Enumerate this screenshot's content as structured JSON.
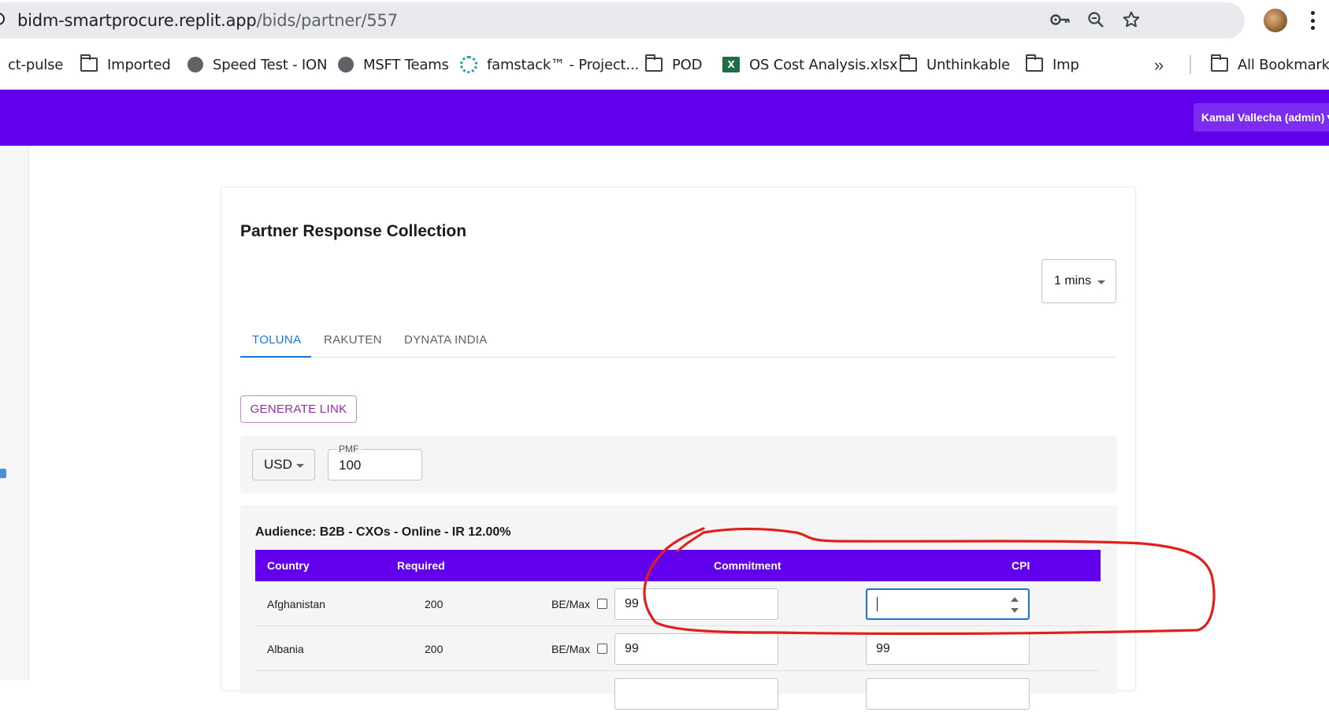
{
  "browser": {
    "url_host": "bidm-smartprocure.replit.app",
    "url_path": "/bids/partner/557",
    "bookmarks": [
      {
        "label": "ct-pulse",
        "icon": "none"
      },
      {
        "label": "Imported",
        "icon": "folder-icon"
      },
      {
        "label": "Speed Test - ION",
        "icon": "globe-icon"
      },
      {
        "label": "MSFT Teams",
        "icon": "globe-icon"
      },
      {
        "label": "famstack™ - Project...",
        "icon": "gear-icon"
      },
      {
        "label": "POD",
        "icon": "folder-icon"
      },
      {
        "label": "OS Cost Analysis.xlsx",
        "icon": "excel-icon"
      },
      {
        "label": "Unthinkable",
        "icon": "folder-icon"
      },
      {
        "label": "Imp",
        "icon": "folder-icon"
      }
    ],
    "all_bookmarks": "All Bookmarks",
    "more_bookmarks": "»"
  },
  "header": {
    "user_menu": "Kamal Vallecha (admin)▼",
    "accent_color": "#6200ee"
  },
  "page": {
    "title": "Partner Response Collection",
    "timer_value": "1 mins",
    "tabs": [
      {
        "label": "TOLUNA",
        "active": true
      },
      {
        "label": "RAKUTEN",
        "active": false
      },
      {
        "label": "DYNATA INDIA",
        "active": false
      }
    ],
    "generate_link": "GENERATE LINK",
    "currency": "USD",
    "pmf_label": "PMF",
    "pmf_value": "100"
  },
  "audience": {
    "title": "Audience: B2B - CXOs - Online - IR 12.00%",
    "columns": {
      "country": "Country",
      "required": "Required",
      "commitment": "Commitment",
      "cpi": "CPI"
    },
    "rows": [
      {
        "country": "Afghanistan",
        "required": "200",
        "be_max_label": "BE/Max",
        "commitment": "99",
        "cpi": ""
      },
      {
        "country": "Albania",
        "required": "200",
        "be_max_label": "BE/Max",
        "commitment": "99",
        "cpi": "99"
      }
    ]
  },
  "annotation": {
    "color": "#e0201b"
  }
}
